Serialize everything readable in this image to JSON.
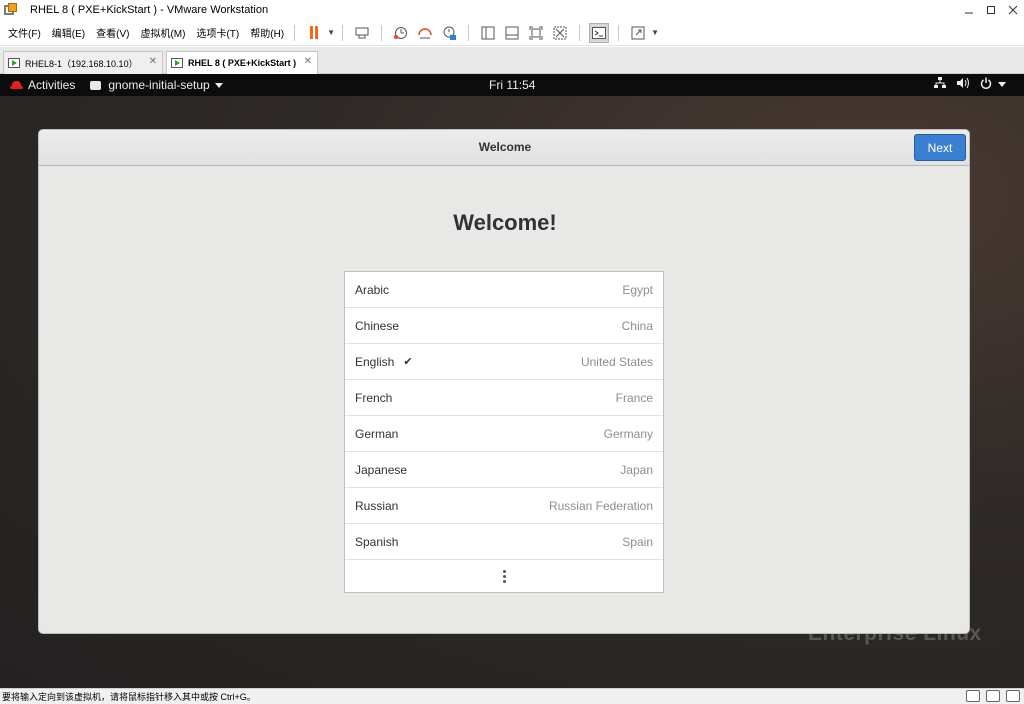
{
  "window": {
    "title": "RHEL 8 ( PXE+KickStart ) - VMware Workstation",
    "controls": [
      "minimize",
      "maximize",
      "close"
    ]
  },
  "menubar": {
    "items": [
      "文件(F)",
      "编辑(E)",
      "查看(V)",
      "虚拟机(M)",
      "选项卡(T)",
      "帮助(H)"
    ]
  },
  "toolbar": {
    "icons": [
      "pause-icon",
      "send-ctrl-alt-del-icon",
      "snapshot-icon",
      "revert-snapshot-icon",
      "snapshot-manager-icon",
      "library-icon",
      "thumbnail-icon",
      "full-screen-icon",
      "unity-icon",
      "console-view-icon",
      "stretch-icon"
    ]
  },
  "tabs": [
    {
      "label": "RHEL8-1（192.168.10.10）",
      "active": false
    },
    {
      "label": "RHEL 8 ( PXE+KickStart )",
      "active": true
    }
  ],
  "gnome_top_bar": {
    "activities": "Activities",
    "app_name": "gnome-initial-setup",
    "clock": "Fri 11:54"
  },
  "dialog": {
    "title": "Welcome",
    "next_label": "Next",
    "heading": "Welcome!"
  },
  "languages": [
    {
      "name": "Arabic",
      "region": "Egypt",
      "selected": false
    },
    {
      "name": "Chinese",
      "region": "China",
      "selected": false
    },
    {
      "name": "English",
      "region": "United States",
      "selected": true
    },
    {
      "name": "French",
      "region": "France",
      "selected": false
    },
    {
      "name": "German",
      "region": "Germany",
      "selected": false
    },
    {
      "name": "Japanese",
      "region": "Japan",
      "selected": false
    },
    {
      "name": "Russian",
      "region": "Russian Federation",
      "selected": false
    },
    {
      "name": "Spanish",
      "region": "Spain",
      "selected": false
    }
  ],
  "checkmark": "✔",
  "watermark": "Enterprise Linux",
  "statusbar": {
    "text": "要将输入定向到该虚拟机，请将鼠标指针移入其中或按 Ctrl+G。"
  },
  "colors": {
    "accent_button": "#3b7fd1",
    "redhat_red": "#e0211e",
    "pause_orange": "#f26b1d"
  }
}
